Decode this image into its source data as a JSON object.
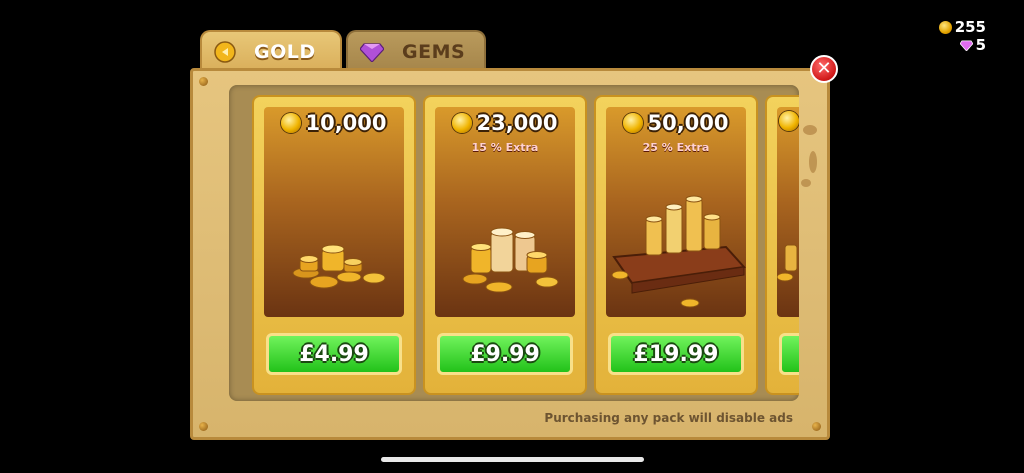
{
  "currency": {
    "gold": "255",
    "gems": "5"
  },
  "tabs": [
    {
      "label": "GOLD",
      "active": true,
      "icon": "gold-coin-icon"
    },
    {
      "label": "GEMS",
      "active": false,
      "icon": "gem-icon"
    }
  ],
  "packs": [
    {
      "amount": "10,000",
      "extra": "",
      "price": "£4.99"
    },
    {
      "amount": "23,000",
      "extra": "15 % Extra",
      "price": "£9.99"
    },
    {
      "amount": "50,000",
      "extra": "25 % Extra",
      "price": "£19.99"
    }
  ],
  "note": "Purchasing any pack will disable ads",
  "colors": {
    "buy_button": "#2fd124",
    "panel": "#dfbd74",
    "close_button": "#d01818"
  }
}
